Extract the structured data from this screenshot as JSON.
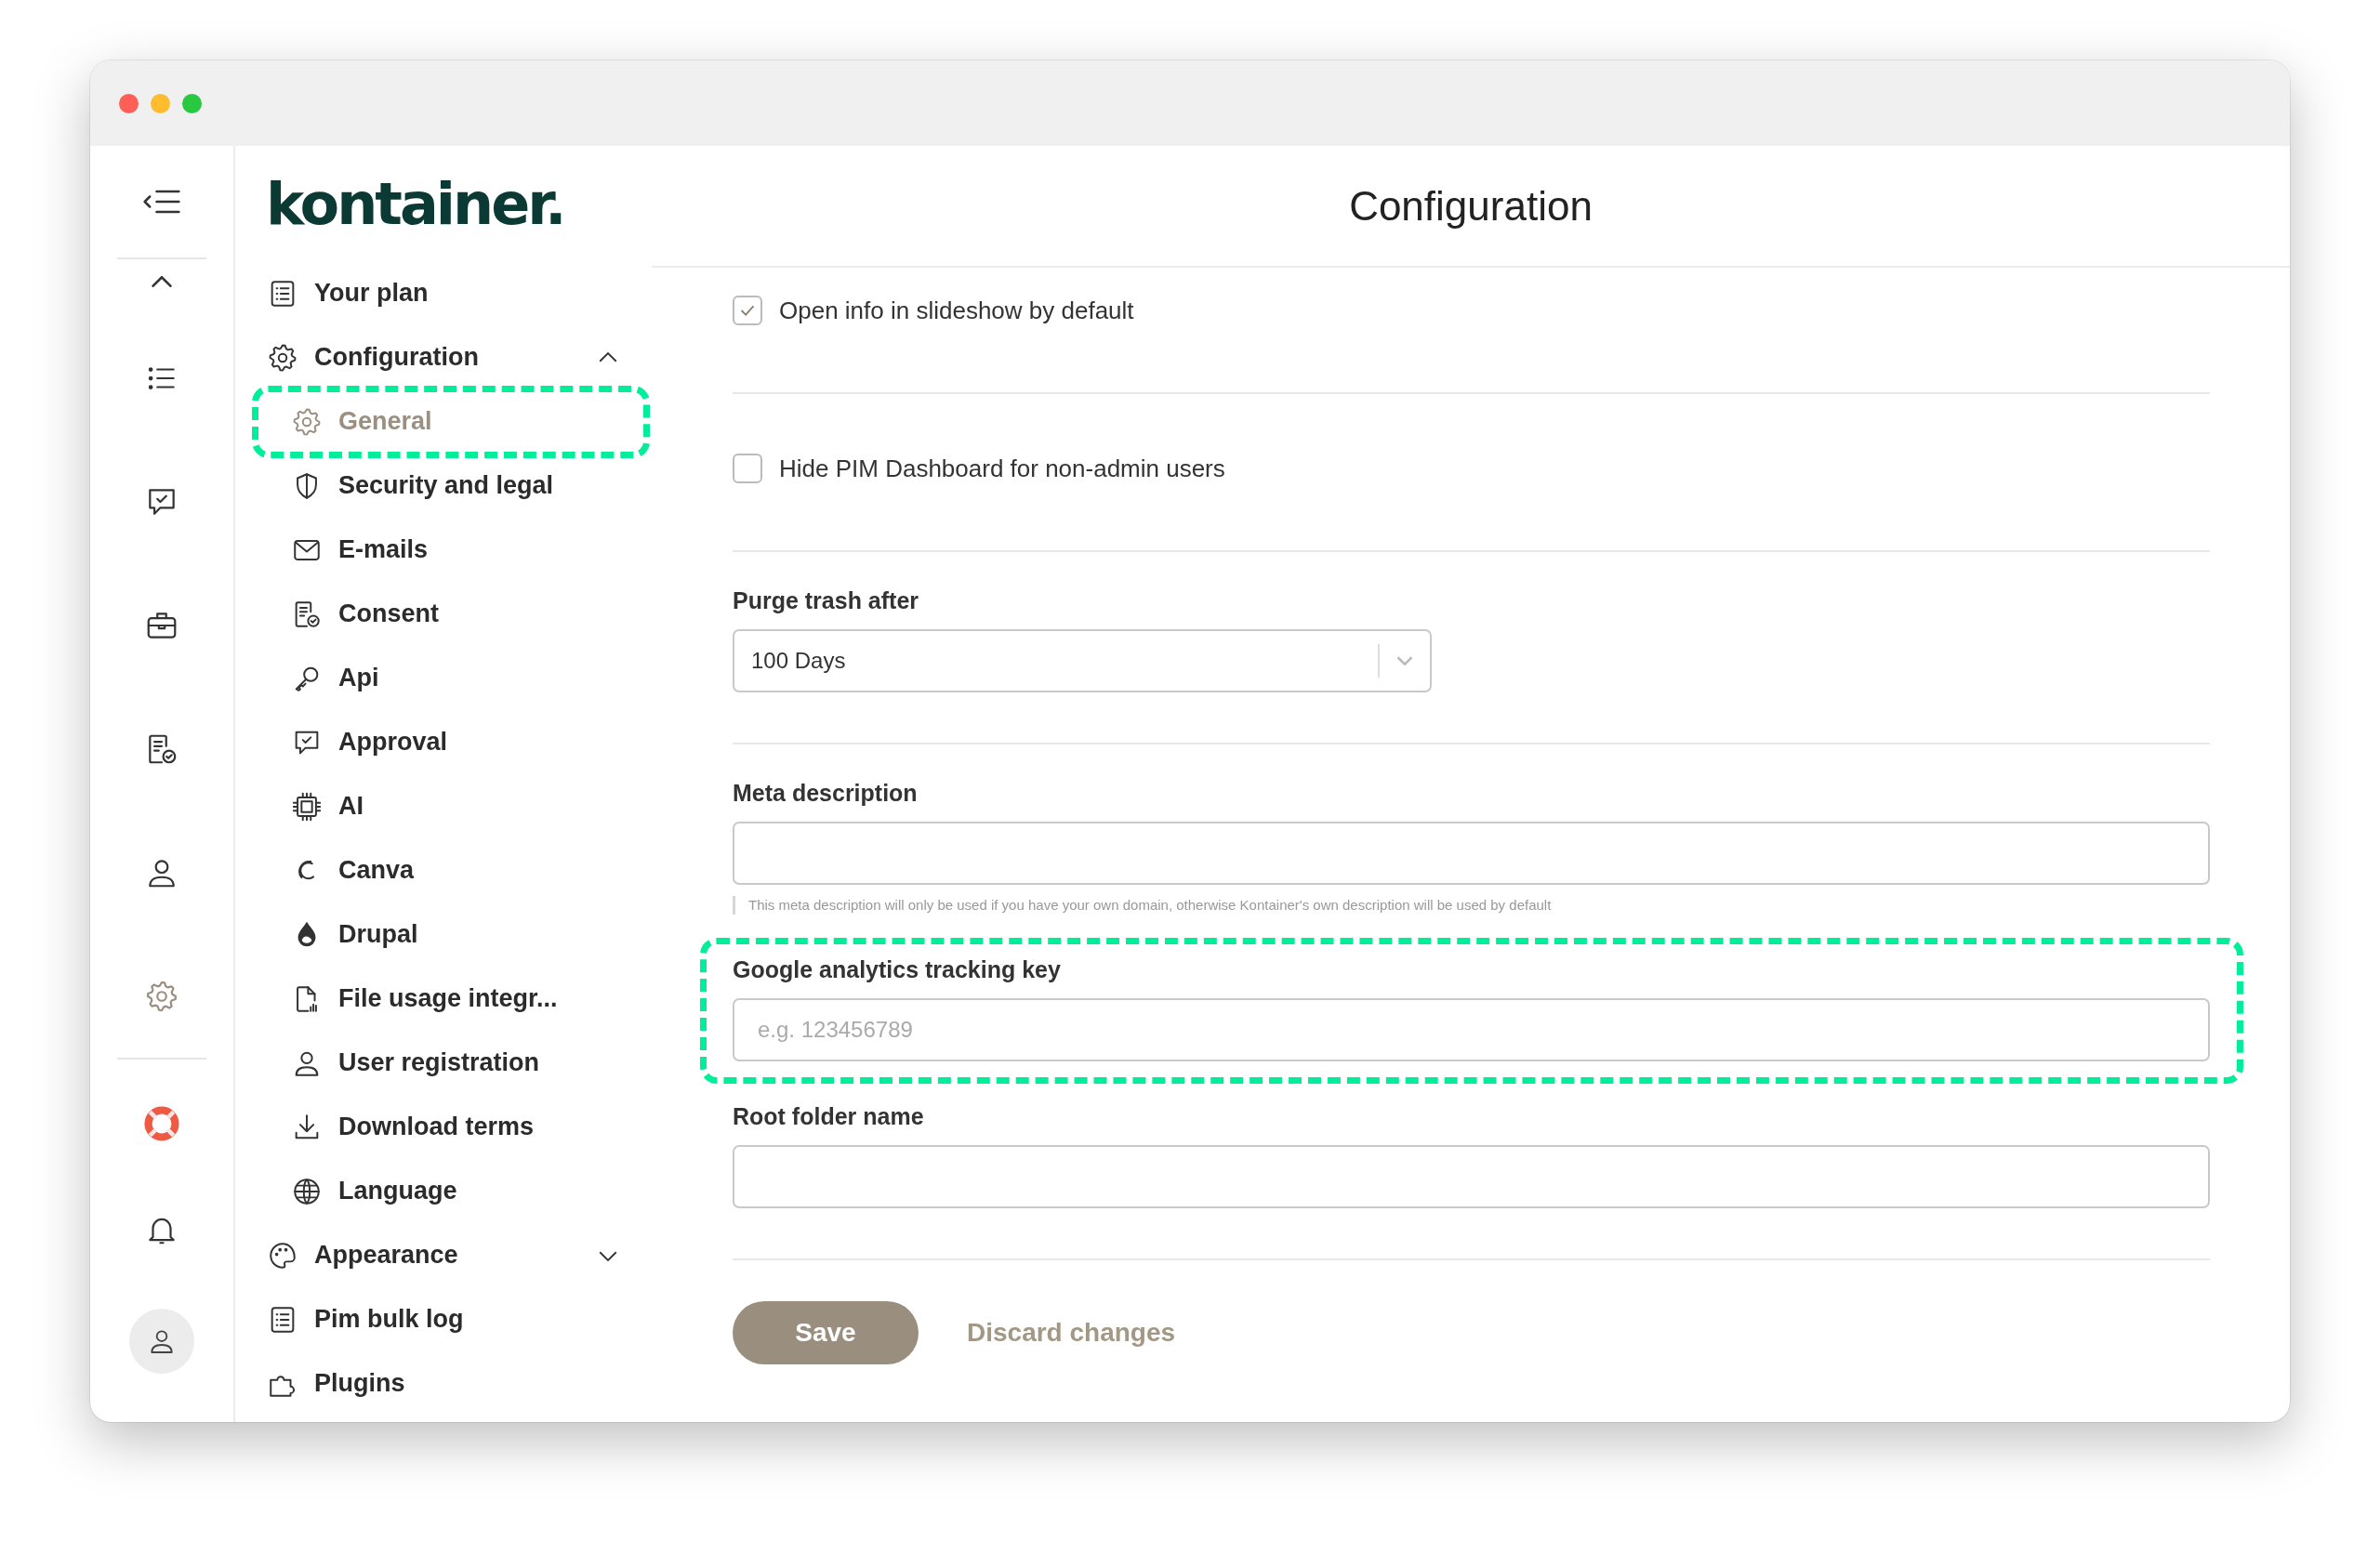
{
  "window": {
    "controls": [
      {
        "color": "#ff5f57"
      },
      {
        "color": "#febc2e"
      },
      {
        "color": "#28c840"
      }
    ]
  },
  "rail": {
    "items": [
      {
        "selected": false
      },
      {
        "selected": false
      },
      {
        "selected": false
      },
      {
        "selected": false
      },
      {
        "selected": false
      },
      {
        "selected": true
      },
      {
        "selected": false
      },
      {
        "selected": false
      },
      {
        "selected": false
      }
    ]
  },
  "logo": "kontainer.",
  "nav": [
    {
      "label": "Your plan",
      "selected": false
    },
    {
      "label": "Configuration",
      "selected": false,
      "expanded": true,
      "children": [
        {
          "label": "General",
          "selected": true,
          "highlighted": true
        },
        {
          "label": "Security and legal",
          "selected": false
        },
        {
          "label": "E-mails",
          "selected": false
        },
        {
          "label": "Consent",
          "selected": false
        },
        {
          "label": "Api",
          "selected": false
        },
        {
          "label": "Approval",
          "selected": false
        },
        {
          "label": "AI",
          "selected": false
        },
        {
          "label": "Canva",
          "selected": false
        },
        {
          "label": "Drupal",
          "selected": false
        },
        {
          "label": "File usage integr...",
          "selected": false
        },
        {
          "label": "User registration",
          "selected": false
        },
        {
          "label": "Download terms",
          "selected": false
        },
        {
          "label": "Language",
          "selected": false
        }
      ]
    },
    {
      "label": "Appearance",
      "selected": false,
      "expanded": false
    },
    {
      "label": "Pim bulk log",
      "selected": false
    },
    {
      "label": "Plugins",
      "selected": false
    }
  ],
  "page_title": "Configuration",
  "sections": [
    {
      "fields": [
        {
          "kind": "checkbox",
          "label": "Open info in slideshow by default",
          "checked": true
        }
      ]
    },
    {
      "fields": [
        {
          "kind": "checkbox",
          "label": "Hide PIM Dashboard for non-admin users",
          "checked": false
        }
      ]
    },
    {
      "fields": [
        {
          "kind": "select",
          "label": "Purge trash after",
          "value": "100 Days"
        }
      ]
    },
    {
      "fields": [
        {
          "kind": "text",
          "label": "Meta description",
          "hint": "This meta description will only be used if you have your own domain, otherwise Kontainer's own description will be used by default"
        },
        {
          "kind": "text",
          "label": "Google analytics tracking key",
          "placeholder": "e.g. 123456789",
          "highlighted": true
        },
        {
          "kind": "text",
          "label": "Root folder name"
        }
      ]
    }
  ],
  "actions": {
    "save": "Save",
    "discard": "Discard changes"
  }
}
